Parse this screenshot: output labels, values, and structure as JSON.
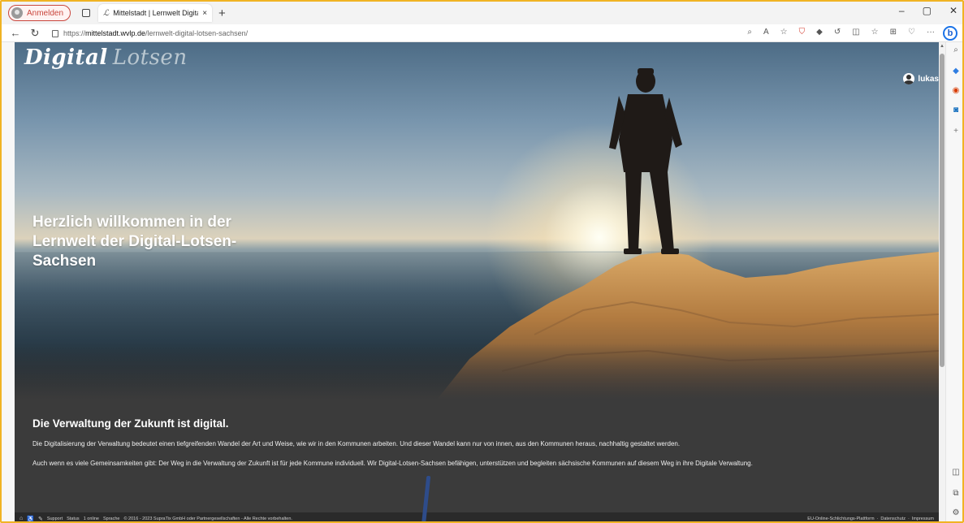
{
  "browser": {
    "profile_label": "Anmelden",
    "tab_favicon": "ℒ",
    "tab_title": "Mittelstadt | Lernwelt Digital Lots",
    "tab_close": "×",
    "new_tab": "+",
    "window_controls": [
      "–",
      "▢",
      "✕"
    ],
    "url_prefix": "https://",
    "url_host": "mittelstadt.wvlp.de",
    "url_path": "/lernwelt-digital-lotsen-sachsen/",
    "nav": {
      "back": "←",
      "reload": "↻"
    },
    "toolbar_icons": [
      "search-icon",
      "read-aloud-icon",
      "favorite-star-icon",
      "extension-shield-icon",
      "extension-icon",
      "refresh-extension-icon",
      "split-screen-icon",
      "favorites-icon",
      "collections-icon",
      "browser-essentials-icon",
      "more-icon"
    ],
    "toolbar_glyphs": [
      "⌕",
      "A",
      "☆",
      "⛉",
      "◆",
      "↺",
      "◫",
      "☆",
      "⊞",
      "♡",
      "···"
    ],
    "bing_label": "b"
  },
  "page": {
    "logo_word1": "Digital",
    "logo_word2": "Lotsen",
    "user_name": "lukas",
    "hero_title": "Herzlich willkommen in der Lernwelt der Digital-Lotsen-Sachsen",
    "section_heading": "Die Verwaltung der Zukunft ist digital.",
    "paragraph_1": "Die Digitalisierung der Verwaltung bedeutet einen tiefgreifenden Wandel der Art und Weise, wie wir in den Kommunen arbeiten. Und dieser Wandel kann nur von innen, aus den Kommunen heraus, nachhaltig gestaltet werden.",
    "paragraph_2": "Auch wenn es viele Gemeinsamkeiten gibt: Der Weg in die Verwaltung der Zukunft ist für jede Kommune individuell. Wir Digital-Lotsen-Sachsen befähigen, unterstützen und begleiten sächsische Kommunen auf diesem Weg in ihre Digitale Verwaltung.",
    "footer_left": [
      "Support",
      "Status",
      "1 online",
      "Sprache",
      "© 2016 - 2023 SupraTix GmbH oder Partnergesellschaften - Alle Rechte vorbehalten."
    ],
    "footer_right": [
      "EU-Online-Schlichtungs-Plattform",
      "Datenschutz",
      "Impressum"
    ]
  },
  "sidebar": {
    "icons": [
      "search-icon",
      "shopping-tag-icon",
      "office-icon",
      "outlook-icon",
      "add-icon",
      "sidebar-layout-icon",
      "external-window-icon",
      "settings-icon"
    ],
    "glyphs": [
      "⌕",
      "◆",
      "◉",
      "◙",
      "+",
      "◫",
      "⧉",
      "⚙"
    ],
    "colors": [
      "#555555",
      "#2f7de1",
      "#d83b01",
      "#0f6cbd",
      "#777777",
      "#555555",
      "#555555",
      "#555555"
    ]
  },
  "colors": {
    "window_accent": "#f0b323",
    "profile_red": "#c9463d",
    "page_dark": "#3b3b3b",
    "bing_blue": "#1a73e8"
  }
}
